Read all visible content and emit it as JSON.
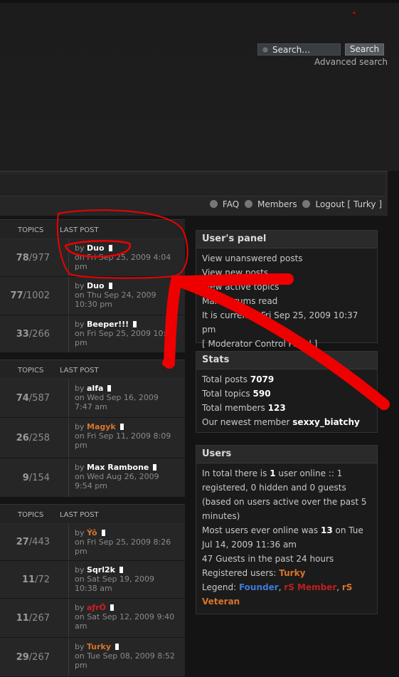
{
  "header": {
    "search_placeholder": "Search…",
    "search_button": "Search",
    "advanced_search": "Advanced search"
  },
  "nav": {
    "faq": "FAQ",
    "members": "Members",
    "logout": "Logout [ Turky ]"
  },
  "columns": {
    "topics": "TOPICS",
    "last_post": "LAST POST"
  },
  "forums": [
    {
      "rows": [
        {
          "topics": "78",
          "posts": "/977",
          "user": "Duo",
          "user_class": "",
          "date": "on Fri Sep 25, 2009 4:04",
          "time": "pm"
        },
        {
          "topics": "77",
          "posts": "/1002",
          "user": "Duo",
          "user_class": "",
          "date": "on Thu Sep 24, 2009",
          "time": "10:30 pm"
        },
        {
          "topics": "33",
          "posts": "/266",
          "user": "Beeper!!!",
          "user_class": "",
          "date": "on Fri Sep 25, 2009 10:44",
          "time": "pm"
        }
      ]
    },
    {
      "rows": [
        {
          "topics": "74",
          "posts": "/587",
          "user": "alfa",
          "user_class": "",
          "date": "on Wed Sep 16, 2009",
          "time": "7:47 am"
        },
        {
          "topics": "26",
          "posts": "/258",
          "user": "Magyk",
          "user_class": "orange",
          "date": "on Fri Sep 11, 2009 8:09",
          "time": "pm"
        },
        {
          "topics": "9",
          "posts": "/154",
          "user": "Max Rambone",
          "user_class": "",
          "date": "on Wed Aug 26, 2009",
          "time": "9:54 pm"
        }
      ]
    },
    {
      "rows": [
        {
          "topics": "27",
          "posts": "/443",
          "user": "Ýô",
          "user_class": "orange",
          "date": "on Fri Sep 25, 2009 8:26",
          "time": "pm"
        },
        {
          "topics": "11",
          "posts": "/72",
          "user": "Sqrl2k",
          "user_class": "",
          "date": "on Sat Sep 19, 2009",
          "time": "10:38 am"
        },
        {
          "topics": "11",
          "posts": "/267",
          "user": "aƒrÖ",
          "user_class": "red",
          "date": "on Sat Sep 12, 2009 9:40",
          "time": "am"
        },
        {
          "topics": "29",
          "posts": "/267",
          "user": "Turky",
          "user_class": "orange",
          "date": "on Tue Sep 08, 2009 8:52",
          "time": "pm"
        }
      ]
    }
  ],
  "users_panel": {
    "title": "User's panel",
    "links": [
      "View unanswered posts",
      "View new posts",
      "View active topics",
      "Mark forums read"
    ],
    "current_time": "It is currently Fri Sep 25, 2009 10:37 pm",
    "mcp": "[ Moderator Control Panel ]"
  },
  "stats": {
    "title": "Stats",
    "total_posts_label": "Total posts",
    "total_posts": "7079",
    "total_topics_label": "Total topics",
    "total_topics": "590",
    "total_members_label": "Total members",
    "total_members": "123",
    "newest_label": "Our newest member",
    "newest": "sexxy_biatchy"
  },
  "users": {
    "title": "Users",
    "online_pre": "In total there is",
    "online_count": "1",
    "online_post": "user online :: 1 registered, 0 hidden and 0 guests (based on users active over the past 5 minutes)",
    "most_pre": "Most users ever online was",
    "most_count": "13",
    "most_post": "on Tue Jul 14, 2009 11:36 am",
    "guests": "47 Guests in the past 24 hours",
    "registered_label": "Registered users:",
    "registered_user": "Turky",
    "legend_label": "Legend:",
    "legend_founder": "Founder",
    "legend_member": "rS Member",
    "legend_veteran": "rS Veteran"
  }
}
